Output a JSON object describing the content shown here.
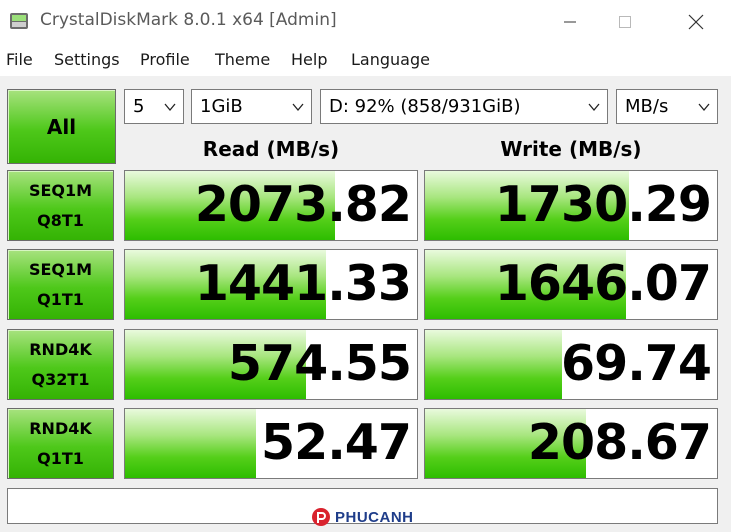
{
  "window": {
    "title": "CrystalDiskMark 8.0.1 x64 [Admin]"
  },
  "menu": [
    "File",
    "Settings",
    "Profile",
    "Theme",
    "Help",
    "Language"
  ],
  "controls": {
    "all_label": "All",
    "count": "5",
    "size": "1GiB",
    "drive": "D: 92% (858/931GiB)",
    "unit": "MB/s"
  },
  "headers": {
    "read": "Read (MB/s)",
    "write": "Write (MB/s)"
  },
  "tests": [
    {
      "line1": "SEQ1M",
      "line2": "Q8T1",
      "read": "2073.82",
      "write": "1730.29",
      "read_fill": 0.72,
      "write_fill": 0.7
    },
    {
      "line1": "SEQ1M",
      "line2": "Q1T1",
      "read": "1441.33",
      "write": "1646.07",
      "read_fill": 0.69,
      "write_fill": 0.69
    },
    {
      "line1": "RND4K",
      "line2": "Q32T1",
      "read": "574.55",
      "write": "69.74",
      "read_fill": 0.62,
      "write_fill": 0.47
    },
    {
      "line1": "RND4K",
      "line2": "Q1T1",
      "read": "52.47",
      "write": "208.67",
      "read_fill": 0.45,
      "write_fill": 0.55
    }
  ],
  "comment": "",
  "watermark": {
    "text": "PHUCANH"
  },
  "colors": {
    "accent_green": "#34b304",
    "title_gray": "#5a5a5a",
    "watermark_red": "#d9232e",
    "watermark_blue": "#1f3d8a"
  },
  "icons": {
    "app": "crystaldiskmark-icon",
    "minimize": "minimize-icon",
    "maximize": "maximize-icon",
    "close": "close-icon",
    "dropdown": "chevron-down-icon"
  }
}
